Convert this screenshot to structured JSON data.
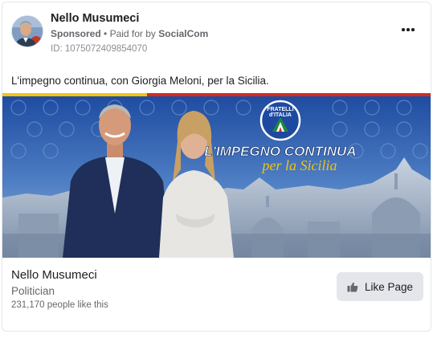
{
  "header": {
    "page_name": "Nello Musumeci",
    "sponsored": "Sponsored",
    "separator": "•",
    "paid_for_prefix": "Paid for by",
    "paid_for_by": "SocialCom",
    "ad_id": "ID: 1075072409854070"
  },
  "post": {
    "body_text": "L'impegno continua, con Giorgia Meloni, per la Sicilia."
  },
  "creative": {
    "party_line1": "FRATELLI",
    "party_line2": "d'ITALIA",
    "slogan": "L'IMPEGNO CONTINUA",
    "slogan_script": "per la Sicilia"
  },
  "footer": {
    "page_name": "Nello Musumeci",
    "category": "Politician",
    "likes": "231,170 people like this",
    "like_button": "Like Page"
  },
  "icons": {
    "more": "more-options-icon",
    "like": "thumbs-up-icon"
  },
  "colors": {
    "text_primary": "#1c1e21",
    "text_secondary": "#65676b",
    "button_bg": "#e4e6eb",
    "banner_blue": "#1d4aa0",
    "banner_yellow": "#f1c40f",
    "banner_red": "#d52b1e"
  }
}
